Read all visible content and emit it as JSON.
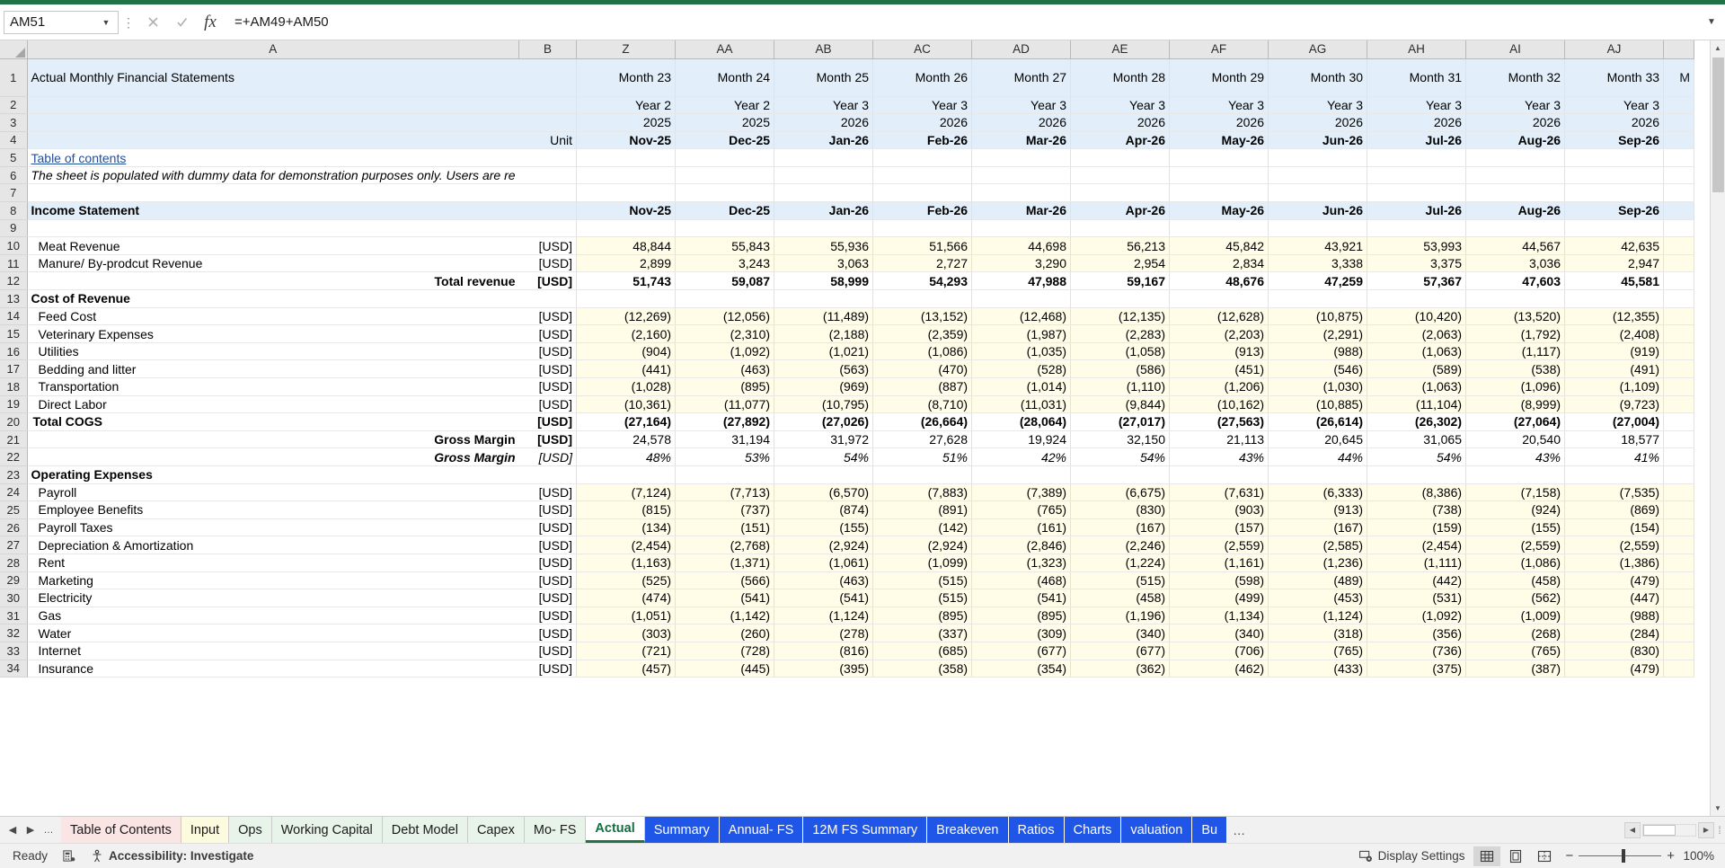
{
  "formula_bar": {
    "name_box": "AM51",
    "formula": "=+AM49+AM50",
    "cancel_icon": "close-icon",
    "confirm_icon": "check-icon",
    "function_icon": "fx-icon",
    "expand_icon": "chevron-down-icon"
  },
  "columns": {
    "headers": [
      "A",
      "B",
      "Z",
      "AA",
      "AB",
      "AC",
      "AD",
      "AE",
      "AF",
      "AG",
      "AH",
      "AI",
      "AJ",
      "A"
    ],
    "last_partial": "A"
  },
  "sheet": {
    "title": "Actual Monthly Financial Statements",
    "unit_label": "Unit",
    "table_of_contents": "Table of contents",
    "note": "The sheet is populated with dummy data for demonstration purposes only. Users are re",
    "income_statement_label": "Income Statement",
    "month_numbers": [
      "Month 23",
      "Month 24",
      "Month 25",
      "Month 26",
      "Month 27",
      "Month 28",
      "Month 29",
      "Month 30",
      "Month 31",
      "Month 32",
      "Month 33"
    ],
    "year_labels": [
      "Year 2",
      "Year 2",
      "Year 3",
      "Year 3",
      "Year 3",
      "Year 3",
      "Year 3",
      "Year 3",
      "Year 3",
      "Year 3",
      "Year 3"
    ],
    "calendar_years": [
      "2025",
      "2025",
      "2026",
      "2026",
      "2026",
      "2026",
      "2026",
      "2026",
      "2026",
      "2026",
      "2026"
    ],
    "period_labels": [
      "Nov-25",
      "Dec-25",
      "Jan-26",
      "Feb-26",
      "Mar-26",
      "Apr-26",
      "May-26",
      "Jun-26",
      "Jul-26",
      "Aug-26",
      "Sep-26"
    ],
    "unit_usd": "[USD]",
    "section_cost_of_revenue": "Cost  of Revenue",
    "section_operating_expenses": "Operating Expenses",
    "total_revenue_label": "Total revenue",
    "gross_margin_label": "Gross Margin",
    "gross_margin_pct_label": "Gross Margin",
    "rows": [
      {
        "n": 10,
        "label": "Meat Revenue",
        "values": [
          "48,844",
          "55,843",
          "55,936",
          "51,566",
          "44,698",
          "56,213",
          "45,842",
          "43,921",
          "53,993",
          "44,567",
          "42,635"
        ]
      },
      {
        "n": 11,
        "label": "Manure/ By-prodcut Revenue",
        "values": [
          "2,899",
          "3,243",
          "3,063",
          "2,727",
          "3,290",
          "2,954",
          "2,834",
          "3,338",
          "3,375",
          "3,036",
          "2,947"
        ]
      },
      {
        "n": 12,
        "label": "Total revenue",
        "values": [
          "51,743",
          "59,087",
          "58,999",
          "54,293",
          "47,988",
          "59,167",
          "48,676",
          "47,259",
          "57,367",
          "47,603",
          "45,581"
        ]
      },
      {
        "n": 14,
        "label": "Feed Cost",
        "values": [
          "(12,269)",
          "(12,056)",
          "(11,489)",
          "(13,152)",
          "(12,468)",
          "(12,135)",
          "(12,628)",
          "(10,875)",
          "(10,420)",
          "(13,520)",
          "(12,355)"
        ]
      },
      {
        "n": 15,
        "label": "Veterinary Expenses",
        "values": [
          "(2,160)",
          "(2,310)",
          "(2,188)",
          "(2,359)",
          "(1,987)",
          "(2,283)",
          "(2,203)",
          "(2,291)",
          "(2,063)",
          "(1,792)",
          "(2,408)"
        ]
      },
      {
        "n": 16,
        "label": "Utilities",
        "values": [
          "(904)",
          "(1,092)",
          "(1,021)",
          "(1,086)",
          "(1,035)",
          "(1,058)",
          "(913)",
          "(988)",
          "(1,063)",
          "(1,117)",
          "(919)"
        ]
      },
      {
        "n": 17,
        "label": "Bedding and litter",
        "values": [
          "(441)",
          "(463)",
          "(563)",
          "(470)",
          "(528)",
          "(586)",
          "(451)",
          "(546)",
          "(589)",
          "(538)",
          "(491)"
        ]
      },
      {
        "n": 18,
        "label": "Transportation",
        "values": [
          "(1,028)",
          "(895)",
          "(969)",
          "(887)",
          "(1,014)",
          "(1,110)",
          "(1,206)",
          "(1,030)",
          "(1,063)",
          "(1,096)",
          "(1,109)"
        ]
      },
      {
        "n": 19,
        "label": "Direct Labor",
        "values": [
          "(10,361)",
          "(11,077)",
          "(10,795)",
          "(8,710)",
          "(11,031)",
          "(9,844)",
          "(10,162)",
          "(10,885)",
          "(11,104)",
          "(8,999)",
          "(9,723)"
        ]
      },
      {
        "n": 20,
        "label": "Total COGS",
        "values": [
          "(27,164)",
          "(27,892)",
          "(27,026)",
          "(26,664)",
          "(28,064)",
          "(27,017)",
          "(27,563)",
          "(26,614)",
          "(26,302)",
          "(27,064)",
          "(27,004)"
        ]
      },
      {
        "n": 21,
        "label": "Gross Margin",
        "values": [
          "24,578",
          "31,194",
          "31,972",
          "27,628",
          "19,924",
          "32,150",
          "21,113",
          "20,645",
          "31,065",
          "20,540",
          "18,577"
        ]
      },
      {
        "n": 22,
        "label": "Gross Margin",
        "values": [
          "48%",
          "53%",
          "54%",
          "51%",
          "42%",
          "54%",
          "43%",
          "44%",
          "54%",
          "43%",
          "41%"
        ]
      },
      {
        "n": 24,
        "label": "Payroll",
        "values": [
          "(7,124)",
          "(7,713)",
          "(6,570)",
          "(7,883)",
          "(7,389)",
          "(6,675)",
          "(7,631)",
          "(6,333)",
          "(8,386)",
          "(7,158)",
          "(7,535)"
        ]
      },
      {
        "n": 25,
        "label": "Employee Benefits",
        "values": [
          "(815)",
          "(737)",
          "(874)",
          "(891)",
          "(765)",
          "(830)",
          "(903)",
          "(913)",
          "(738)",
          "(924)",
          "(869)"
        ]
      },
      {
        "n": 26,
        "label": "Payroll Taxes",
        "values": [
          "(134)",
          "(151)",
          "(155)",
          "(142)",
          "(161)",
          "(167)",
          "(157)",
          "(167)",
          "(159)",
          "(155)",
          "(154)"
        ]
      },
      {
        "n": 27,
        "label": "Depreciation & Amortization",
        "values": [
          "(2,454)",
          "(2,768)",
          "(2,924)",
          "(2,924)",
          "(2,846)",
          "(2,246)",
          "(2,559)",
          "(2,585)",
          "(2,454)",
          "(2,559)",
          "(2,559)"
        ]
      },
      {
        "n": 28,
        "label": "Rent",
        "values": [
          "(1,163)",
          "(1,371)",
          "(1,061)",
          "(1,099)",
          "(1,323)",
          "(1,224)",
          "(1,161)",
          "(1,236)",
          "(1,111)",
          "(1,086)",
          "(1,386)"
        ]
      },
      {
        "n": 29,
        "label": "Marketing",
        "values": [
          "(525)",
          "(566)",
          "(463)",
          "(515)",
          "(468)",
          "(515)",
          "(598)",
          "(489)",
          "(442)",
          "(458)",
          "(479)"
        ]
      },
      {
        "n": 30,
        "label": "Electricity",
        "values": [
          "(474)",
          "(541)",
          "(541)",
          "(515)",
          "(541)",
          "(458)",
          "(499)",
          "(453)",
          "(531)",
          "(562)",
          "(447)"
        ]
      },
      {
        "n": 31,
        "label": "Gas",
        "values": [
          "(1,051)",
          "(1,142)",
          "(1,124)",
          "(895)",
          "(895)",
          "(1,196)",
          "(1,134)",
          "(1,124)",
          "(1,092)",
          "(1,009)",
          "(988)"
        ]
      },
      {
        "n": 32,
        "label": "Water",
        "values": [
          "(303)",
          "(260)",
          "(278)",
          "(337)",
          "(309)",
          "(340)",
          "(340)",
          "(318)",
          "(356)",
          "(268)",
          "(284)"
        ]
      },
      {
        "n": 33,
        "label": "Internet",
        "values": [
          "(721)",
          "(728)",
          "(816)",
          "(685)",
          "(677)",
          "(677)",
          "(706)",
          "(765)",
          "(736)",
          "(765)",
          "(830)"
        ]
      },
      {
        "n": 34,
        "label": "Insurance",
        "values": [
          "(457)",
          "(445)",
          "(395)",
          "(358)",
          "(354)",
          "(362)",
          "(462)",
          "(433)",
          "(375)",
          "(387)",
          "(479)"
        ]
      }
    ]
  },
  "tabs": {
    "nav_prev_icon": "triangle-left-icon",
    "nav_next_icon": "triangle-right-icon",
    "nav_more": "…",
    "overflow_more": "…",
    "items": [
      {
        "label": "Table of Contents",
        "style": "pink",
        "active": false
      },
      {
        "label": "Input",
        "style": "cream",
        "active": false
      },
      {
        "label": "Ops",
        "style": "mint",
        "active": false
      },
      {
        "label": "Working Capital",
        "style": "mint",
        "active": false
      },
      {
        "label": "Debt Model",
        "style": "mint",
        "active": false
      },
      {
        "label": "Capex",
        "style": "mint",
        "active": false
      },
      {
        "label": "Mo- FS",
        "style": "mint",
        "active": false
      },
      {
        "label": "Actual",
        "style": "plain",
        "active": true
      },
      {
        "label": "Summary",
        "style": "blue",
        "active": false
      },
      {
        "label": "Annual- FS",
        "style": "blue",
        "active": false
      },
      {
        "label": "12M FS Summary",
        "style": "blue",
        "active": false
      },
      {
        "label": "Breakeven",
        "style": "blue",
        "active": false
      },
      {
        "label": "Ratios",
        "style": "blue",
        "active": false
      },
      {
        "label": "Charts",
        "style": "blue",
        "active": false
      },
      {
        "label": "valuation",
        "style": "blue",
        "active": false
      },
      {
        "label": "Bu",
        "style": "blue",
        "active": false
      }
    ]
  },
  "status_bar": {
    "ready": "Ready",
    "macro_icon": "record-macro-icon",
    "accessibility_icon": "accessibility-icon",
    "accessibility": "Accessibility: Investigate",
    "display_settings_icon": "display-settings-icon",
    "display_settings": "Display Settings",
    "view_normal_icon": "normal-view-icon",
    "view_pagelayout_icon": "page-layout-view-icon",
    "view_pagebreak_icon": "page-break-view-icon",
    "zoom_out_icon": "minus-icon",
    "zoom_in_icon": "plus-icon",
    "zoom_level": "100%"
  },
  "colors": {
    "excel_green": "#217346",
    "header_blue": "#e2effa",
    "input_yellow": "#fffce8",
    "formula_blue": "#2424c8",
    "tab_blue": "#1f56e8"
  }
}
